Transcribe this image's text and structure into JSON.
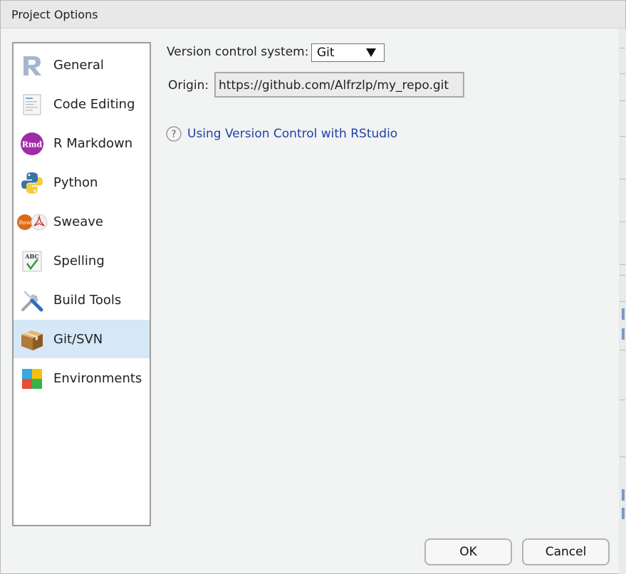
{
  "window": {
    "title": "Project Options"
  },
  "sidebar": {
    "items": [
      {
        "label": "General",
        "icon": "r-logo-icon",
        "selected": false
      },
      {
        "label": "Code Editing",
        "icon": "code-document-icon",
        "selected": false
      },
      {
        "label": "R Markdown",
        "icon": "rmd-icon",
        "selected": false
      },
      {
        "label": "Python",
        "icon": "python-logo-icon",
        "selected": false
      },
      {
        "label": "Sweave",
        "icon": "sweave-pdf-icon",
        "selected": false
      },
      {
        "label": "Spelling",
        "icon": "spelling-check-icon",
        "selected": false
      },
      {
        "label": "Build Tools",
        "icon": "wrench-screwdriver-icon",
        "selected": false
      },
      {
        "label": "Git/SVN",
        "icon": "package-box-icon",
        "selected": true
      },
      {
        "label": "Environments",
        "icon": "environments-blocks-icon",
        "selected": false
      }
    ]
  },
  "vcs": {
    "label": "Version control system:",
    "selected": "Git",
    "icon": "dropdown-arrow-icon"
  },
  "origin": {
    "label": "Origin:",
    "value": "https://github.com/Alfrzlp/my_repo.git"
  },
  "help": {
    "icon": "question-circle-icon",
    "link_text": "Using Version Control with RStudio"
  },
  "buttons": {
    "ok": "OK",
    "cancel": "Cancel"
  },
  "colors": {
    "selection": "#d6e8f7",
    "link": "#1f42a8",
    "background": "#f2f3f3"
  }
}
